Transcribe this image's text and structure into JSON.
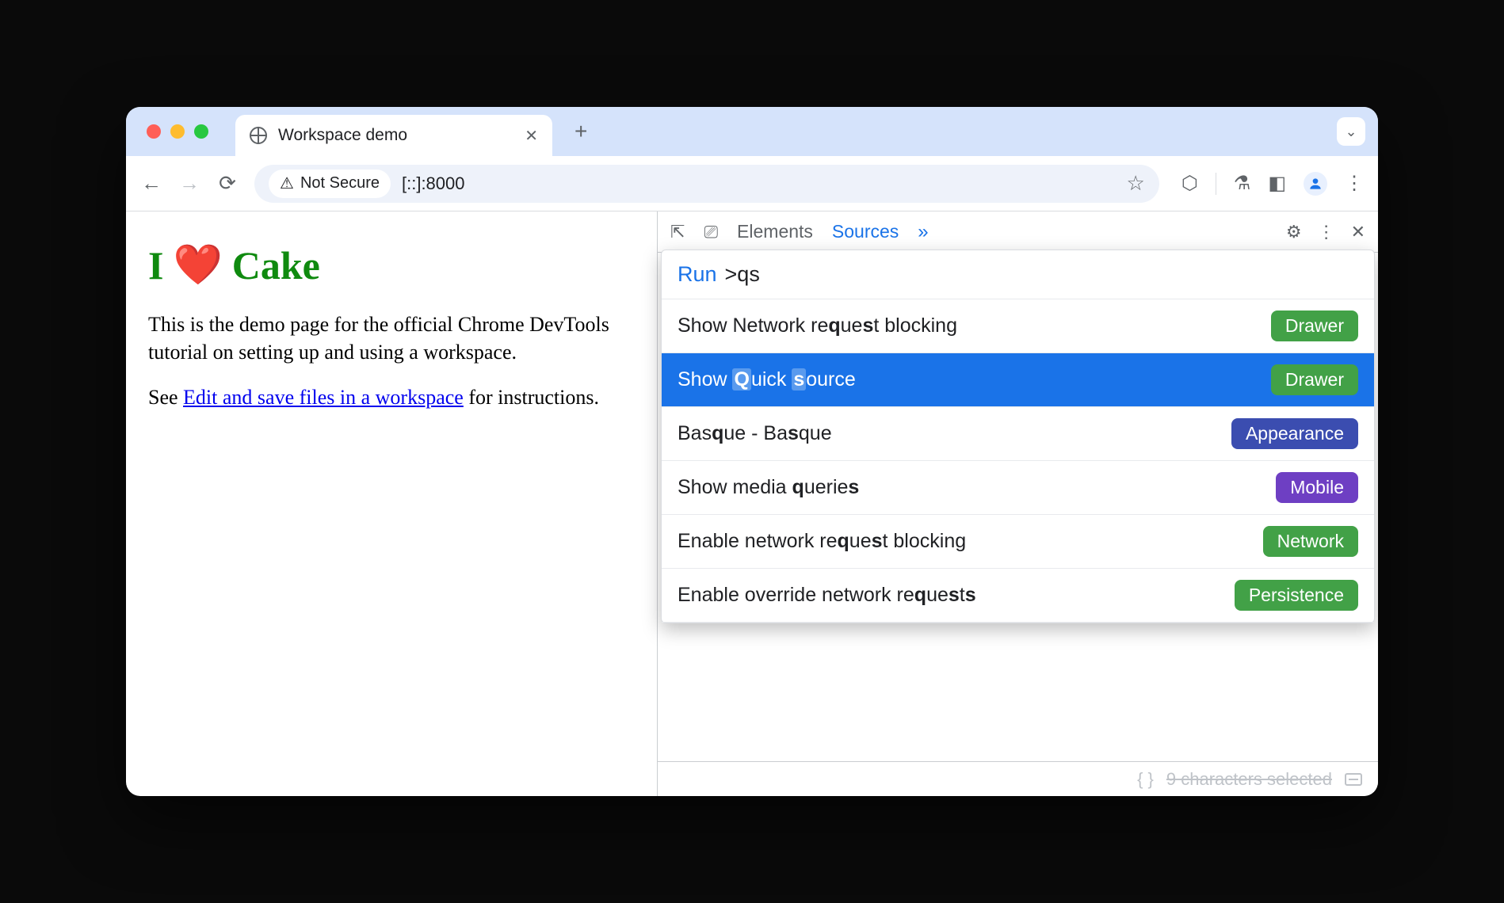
{
  "titlebar": {
    "tab_title": "Workspace demo"
  },
  "toolbar": {
    "secure_label": "Not Secure",
    "url": "[::]:8000"
  },
  "page": {
    "h1_pre": "I",
    "h1_post": "Cake",
    "p1": "This is the demo page for the official Chrome DevTools tutorial on setting up and using a workspace.",
    "p2_pre": "See ",
    "p2_link": "Edit and save files in a workspace",
    "p2_post": " for instructions."
  },
  "devtools": {
    "tabs": {
      "elements": "Elements",
      "sources": "Sources"
    },
    "cmd": {
      "run_label": "Run",
      "query": ">qs",
      "items": [
        {
          "html": "Show Network re<b>q</b>ue<b>s</b>t blocking",
          "badge": "Drawer",
          "badge_class": "b-drawer",
          "selected": false
        },
        {
          "html": "Show <b>Q</b>uick <b>s</b>ource",
          "badge": "Drawer",
          "badge_class": "b-drawer",
          "selected": true
        },
        {
          "html": "Bas<b>q</b>ue - Ba<b>s</b>que",
          "badge": "Appearance",
          "badge_class": "b-appearance",
          "selected": false
        },
        {
          "html": "Show media <b>q</b>uerie<b>s</b>",
          "badge": "Mobile",
          "badge_class": "b-mobile",
          "selected": false
        },
        {
          "html": "Enable network re<b>q</b>ue<b>s</b>t blocking",
          "badge": "Network",
          "badge_class": "b-network",
          "selected": false
        },
        {
          "html": "Enable override network re<b>q</b>ue<b>s</b>t<b>s</b>",
          "badge": "Persistence",
          "badge_class": "b-persistence",
          "selected": false
        }
      ]
    },
    "footer": "9 characters selected"
  }
}
